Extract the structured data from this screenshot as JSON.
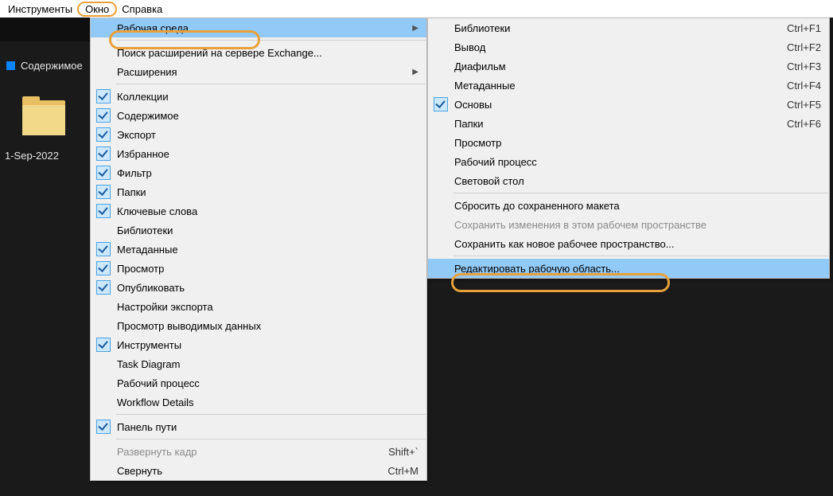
{
  "menubar": {
    "tools": "Инструменты",
    "window": "Окно",
    "help": "Справка"
  },
  "left": {
    "tab": "Содержимое",
    "folder_label": "1-Sep-2022"
  },
  "menu1": {
    "workspace": "Рабочая среда",
    "find_ext": "Поиск расширений на сервере Exchange...",
    "extensions": "Расширения",
    "collections": "Коллекции",
    "content": "Содержимое",
    "export": "Экспорт",
    "favorites": "Избранное",
    "filter": "Фильтр",
    "folders": "Папки",
    "keywords": "Ключевые слова",
    "libraries": "Библиотеки",
    "metadata": "Метаданные",
    "review": "Просмотр",
    "publish": "Опубликовать",
    "export_settings": "Настройки экспорта",
    "output_preview": "Просмотр выводимых данных",
    "tools": "Инструменты",
    "task_diagram": "Task Diagram",
    "workflow": "Рабочий процесс",
    "workflow_details": "Workflow Details",
    "path_bar": "Панель пути",
    "maximize": "Развернуть кадр",
    "minimize": "Свернуть",
    "sc_maximize": "Shift+`",
    "sc_minimize": "Ctrl+M"
  },
  "menu2": {
    "libraries": "Библиотеки",
    "output": "Вывод",
    "filmstrip": "Диафильм",
    "metadata": "Метаданные",
    "essentials": "Основы",
    "folders": "Папки",
    "preview": "Просмотр",
    "workflow": "Рабочий процесс",
    "light_table": "Световой стол",
    "reset": "Сбросить до сохраненного макета",
    "save_changes": "Сохранить изменения в этом рабочем пространстве",
    "save_new": "Сохранить как новое рабочее пространство...",
    "edit_workspace": "Редактировать рабочую область...",
    "sc_f1": "Ctrl+F1",
    "sc_f2": "Ctrl+F2",
    "sc_f3": "Ctrl+F3",
    "sc_f4": "Ctrl+F4",
    "sc_f5": "Ctrl+F5",
    "sc_f6": "Ctrl+F6"
  }
}
